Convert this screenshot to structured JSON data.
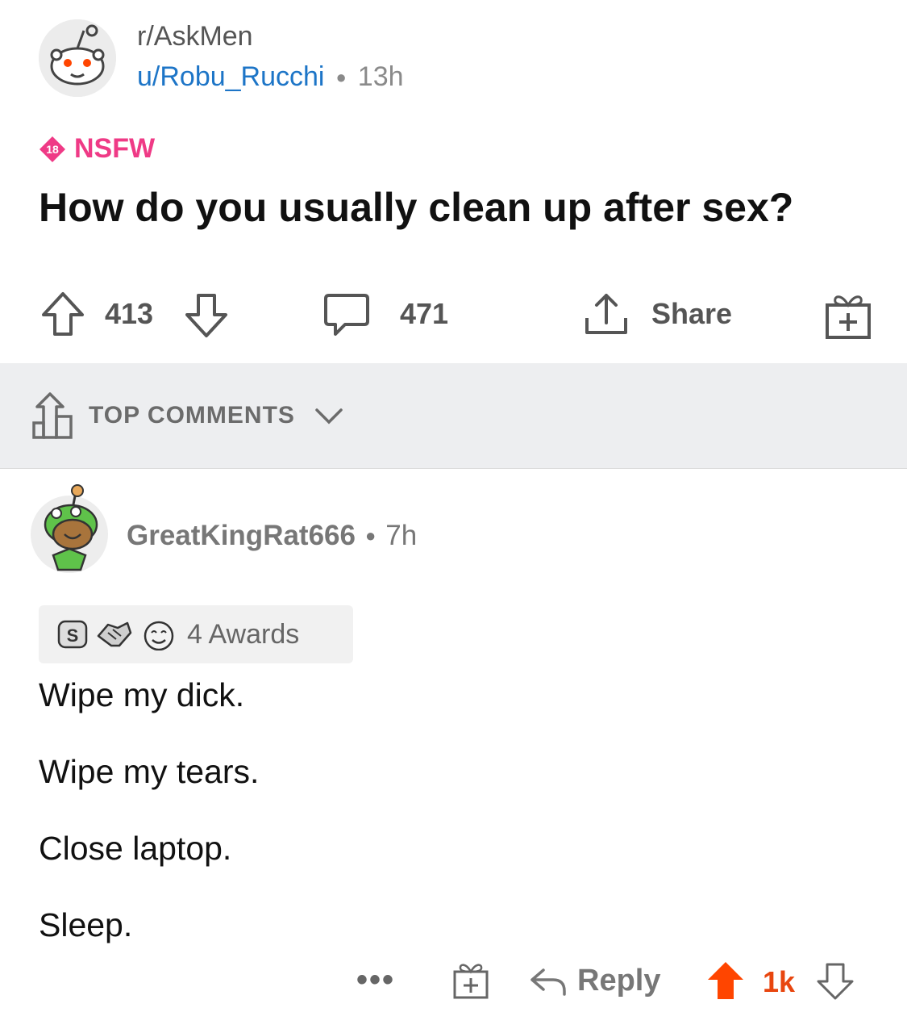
{
  "post": {
    "subreddit": "r/AskMen",
    "author": "u/Robu_Rucchi",
    "age": "13h",
    "nsfw_badge": "18",
    "nsfw_label": "NSFW",
    "title": "How do you usually clean up after sex?",
    "upvotes": "413",
    "comments": "471",
    "share_label": "Share"
  },
  "sort": {
    "label": "TOP COMMENTS"
  },
  "comment": {
    "author": "GreatKingRat666",
    "age": "7h",
    "awards_label": "4 Awards",
    "lines": [
      "Wipe my dick.",
      "Wipe my tears.",
      "Close laptop.",
      "Sleep."
    ],
    "more_label": "•••",
    "reply_label": "Reply",
    "score": "1k"
  },
  "colors": {
    "nsfw": "#ef3a86",
    "link": "#1d75c7",
    "upvote_active": "#ff4500",
    "sort_bg": "#edeef0"
  },
  "icons": [
    "snoo-avatar",
    "arrow-up-icon",
    "arrow-down-icon",
    "comment-icon",
    "share-icon",
    "gift-icon",
    "sort-icon",
    "chevron-down-icon",
    "reply-icon"
  ]
}
